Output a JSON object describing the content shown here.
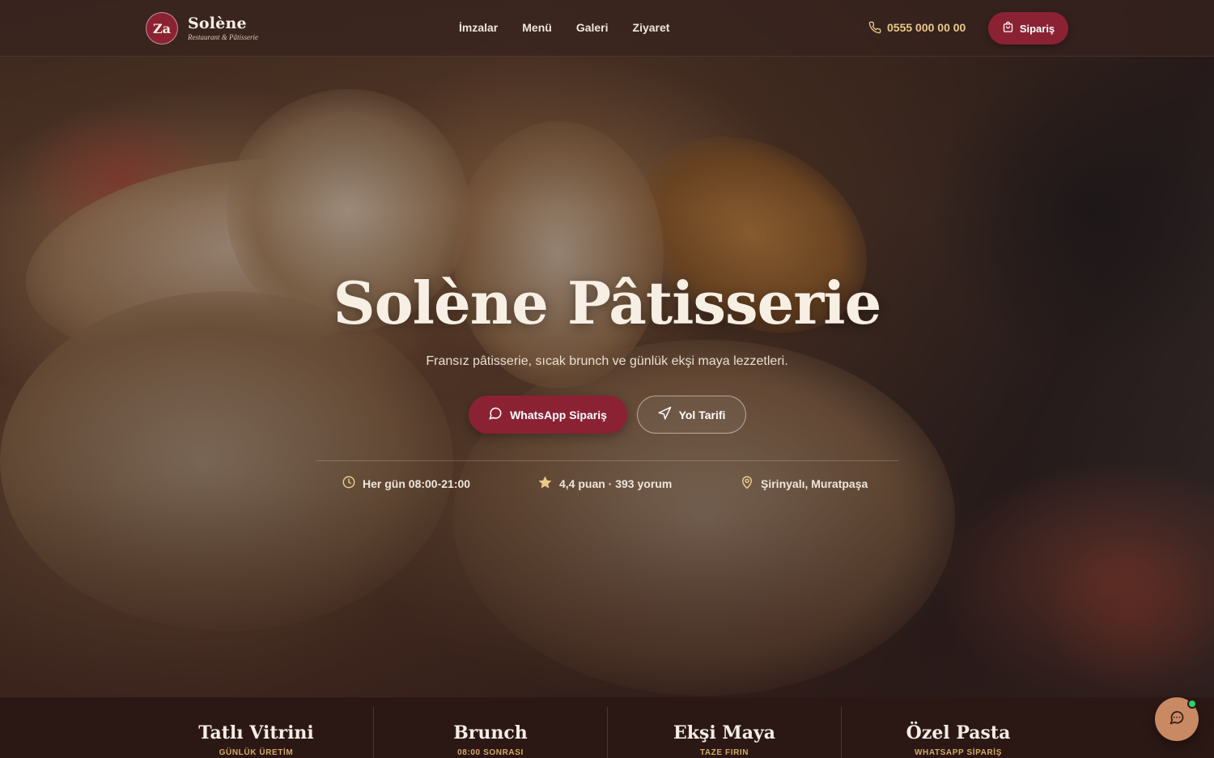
{
  "brand": {
    "mark": "Za",
    "name": "Solène",
    "tagline": "Restaurant & Pâtisserie"
  },
  "nav": {
    "items": [
      "İmzalar",
      "Menü",
      "Galeri",
      "Ziyaret"
    ]
  },
  "header": {
    "phone": "0555 000 00 00",
    "order_label": "Sipariş"
  },
  "hero": {
    "title": "Solène Pâtisserie",
    "subtitle": "Fransız pâtisserie, sıcak brunch ve günlük ekşi maya lezzetleri.",
    "whatsapp_label": "WhatsApp Sipariş",
    "directions_label": "Yol Tarifi"
  },
  "info": {
    "hours": "Her gün 08:00-21:00",
    "rating": "4,4 puan · 393 yorum",
    "location": "Şirinyalı, Muratpaşa"
  },
  "categories": [
    {
      "title": "Tatlı Vitrini",
      "subtitle": "GÜNLÜK ÜRETİM"
    },
    {
      "title": "Brunch",
      "subtitle": "08:00 SONRASI"
    },
    {
      "title": "Ekşi Maya",
      "subtitle": "TAZE FIRIN"
    },
    {
      "title": "Özel Pasta",
      "subtitle": "WHATSAPP SİPARİŞ"
    }
  ],
  "colors": {
    "accent": "#8b2233",
    "gold": "#e9c98b",
    "background": "#2b1815",
    "chat": "#c98963",
    "online": "#2bd46a"
  },
  "icons": {
    "phone": "phone-icon",
    "bag": "shopping-bag-icon",
    "whatsapp": "chat-bubble-icon",
    "directions": "navigation-arrow-icon",
    "clock": "clock-icon",
    "star": "star-icon",
    "pin": "map-pin-icon",
    "chat": "chat-icon"
  }
}
